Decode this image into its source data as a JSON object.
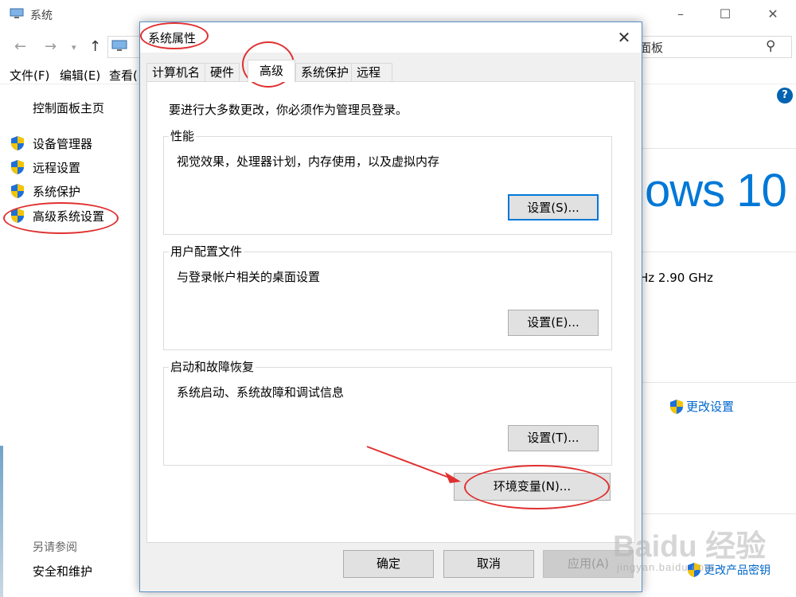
{
  "background_window": {
    "title": "系统",
    "search_text": "面板",
    "menu": [
      "文件(F)",
      "编辑(E)",
      "查看("
    ],
    "left_pane": {
      "home": "控制面板主页",
      "links": [
        "设备管理器",
        "远程设置",
        "系统保护",
        "高级系统设置"
      ],
      "see_also_heading": "另请参阅",
      "see_also_link": "安全和维护"
    },
    "windows_logo_text": "ows 10",
    "cpu_frequency": "Hz   2.90 GHz",
    "change_settings": "更改设置",
    "change_product_key": "更改产品密钥",
    "help": "?"
  },
  "dialog": {
    "title": "系统属性",
    "tabs": [
      "计算机名",
      "硬件",
      "高级",
      "系统保护",
      "远程"
    ],
    "active_tab": "高级",
    "admin_note": "要进行大多数更改，你必须作为管理员登录。",
    "groups": [
      {
        "title": "性能",
        "description": "视觉效果，处理器计划，内存使用，以及虚拟内存",
        "button": "设置(S)..."
      },
      {
        "title": "用户配置文件",
        "description": "与登录帐户相关的桌面设置",
        "button": "设置(E)..."
      },
      {
        "title": "启动和故障恢复",
        "description": "系统启动、系统故障和调试信息",
        "button": "设置(T)..."
      }
    ],
    "env_button": "环境变量(N)...",
    "ok": "确定",
    "cancel": "取消",
    "apply": "应用(A)"
  },
  "watermark": {
    "brand": "Baidu 经验",
    "url": "jingyan.baidu.com"
  },
  "colors": {
    "accent": "#0078d7",
    "annotation": "#e03030",
    "link": "#0066cc",
    "shield_blue": "#1e6fd9",
    "shield_yellow": "#f5c400"
  }
}
